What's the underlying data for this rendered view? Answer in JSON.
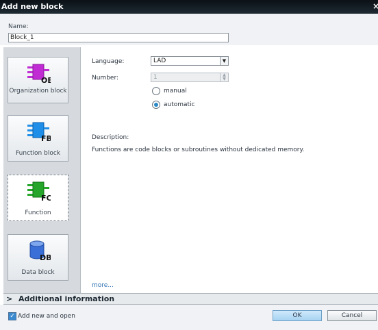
{
  "window": {
    "title": "Add new block",
    "close_label": "×"
  },
  "name": {
    "label": "Name:",
    "value": "Block_1"
  },
  "blocks": [
    {
      "label": "Organization block",
      "badge": "OB",
      "color": "#c02bd4",
      "selected": false
    },
    {
      "label": "Function block",
      "badge": "FB",
      "color": "#1f8ee8",
      "selected": false
    },
    {
      "label": "Function",
      "badge": "FC",
      "color": "#25a62b",
      "selected": true
    },
    {
      "label": "Data block",
      "badge": "DB",
      "color": "#3a6fd8",
      "selected": false
    }
  ],
  "form": {
    "language_label": "Language:",
    "language_value": "LAD",
    "number_label": "Number:",
    "number_value": "1",
    "manual_label": "manual",
    "automatic_label": "automatic",
    "selected_numbering": "automatic"
  },
  "description": {
    "title": "Description:",
    "text": "Functions are code blocks or subroutines without dedicated memory.",
    "more_link": "more..."
  },
  "additional_info": {
    "label": "Additional  information"
  },
  "footer": {
    "add_open_label": "Add new and open",
    "add_open_checked": true,
    "ok_label": "OK",
    "cancel_label": "Cancel"
  },
  "colors": {
    "accent": "#2a89c6",
    "title_bar": "#11191f"
  }
}
